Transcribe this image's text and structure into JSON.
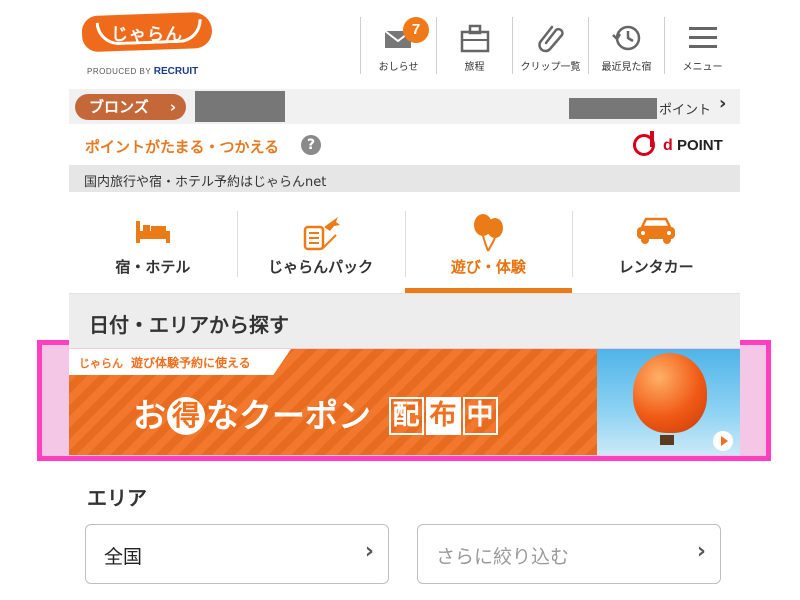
{
  "header": {
    "logo_text": "じゃらん",
    "produced_by": "PRODUCED BY",
    "recruit": "RECRUIT",
    "nav": [
      {
        "icon": "mail-icon",
        "label": "おしらせ",
        "badge": "7"
      },
      {
        "icon": "suitcase-icon",
        "label": "旅程"
      },
      {
        "icon": "paperclip-icon",
        "label": "クリップ一覧"
      },
      {
        "icon": "history-icon",
        "label": "最近見た宿"
      },
      {
        "icon": "menu-icon",
        "label": "メニュー"
      }
    ]
  },
  "member": {
    "rank": "ブロンズ",
    "points_label": "ポイント"
  },
  "point_info": {
    "text": "ポイントがたまる・つかえる",
    "help": "?",
    "dpoint_d": "d",
    "dpoint_label": "POINT"
  },
  "tagline": "国内旅行や宿・ホテル予約はじゃらんnet",
  "category_tabs": [
    {
      "icon": "bed-icon",
      "label": "宿・ホテル",
      "active": false
    },
    {
      "icon": "plane-train-icon",
      "label": "じゃらんパック",
      "active": false
    },
    {
      "icon": "balloon-icon",
      "label": "遊び・体験",
      "active": true
    },
    {
      "icon": "car-icon",
      "label": "レンタカー",
      "active": false
    }
  ],
  "search_section": {
    "title": "日付・エリアから探す"
  },
  "coupon_banner": {
    "logo_mini": "じゃらん",
    "ribbon": "遊び体験予約に使える",
    "main_pre": "お",
    "main_circle": "得",
    "main_mid": "なクーポン",
    "boxed": [
      "配",
      "布",
      "中"
    ]
  },
  "area": {
    "title": "エリア",
    "region_value": "全国",
    "narrow_placeholder": "さらに絞り込む"
  },
  "colors": {
    "brand_orange": "#f07020",
    "rank_bronze": "#c4683a",
    "highlight_pink": "#ff3fbf",
    "dpoint_red": "#d6001c"
  }
}
